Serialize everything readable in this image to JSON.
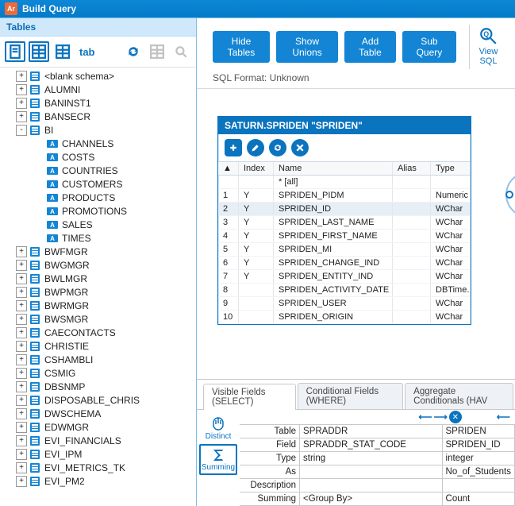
{
  "app": {
    "title": "Build Query",
    "badge": "Ar"
  },
  "left": {
    "panel_title": "Tables",
    "tab_label": "tab",
    "tree": [
      {
        "level": 0,
        "expand": "+",
        "icon": "db",
        "label": "<blank schema>"
      },
      {
        "level": 0,
        "expand": "+",
        "icon": "db",
        "label": "ALUMNI"
      },
      {
        "level": 0,
        "expand": "+",
        "icon": "db",
        "label": "BANINST1"
      },
      {
        "level": 0,
        "expand": "+",
        "icon": "db",
        "label": "BANSECR"
      },
      {
        "level": 0,
        "expand": "-",
        "icon": "db",
        "label": "BI"
      },
      {
        "level": 1,
        "expand": "",
        "icon": "tbl",
        "label": "CHANNELS"
      },
      {
        "level": 1,
        "expand": "",
        "icon": "tbl",
        "label": "COSTS"
      },
      {
        "level": 1,
        "expand": "",
        "icon": "tbl",
        "label": "COUNTRIES"
      },
      {
        "level": 1,
        "expand": "",
        "icon": "tbl",
        "label": "CUSTOMERS"
      },
      {
        "level": 1,
        "expand": "",
        "icon": "tbl",
        "label": "PRODUCTS"
      },
      {
        "level": 1,
        "expand": "",
        "icon": "tbl",
        "label": "PROMOTIONS"
      },
      {
        "level": 1,
        "expand": "",
        "icon": "tbl",
        "label": "SALES"
      },
      {
        "level": 1,
        "expand": "",
        "icon": "tbl",
        "label": "TIMES"
      },
      {
        "level": 0,
        "expand": "+",
        "icon": "db",
        "label": "BWFMGR"
      },
      {
        "level": 0,
        "expand": "+",
        "icon": "db",
        "label": "BWGMGR"
      },
      {
        "level": 0,
        "expand": "+",
        "icon": "db",
        "label": "BWLMGR"
      },
      {
        "level": 0,
        "expand": "+",
        "icon": "db",
        "label": "BWPMGR"
      },
      {
        "level": 0,
        "expand": "+",
        "icon": "db",
        "label": "BWRMGR"
      },
      {
        "level": 0,
        "expand": "+",
        "icon": "db",
        "label": "BWSMGR"
      },
      {
        "level": 0,
        "expand": "+",
        "icon": "db",
        "label": "CAECONTACTS"
      },
      {
        "level": 0,
        "expand": "+",
        "icon": "db",
        "label": "CHRISTIE"
      },
      {
        "level": 0,
        "expand": "+",
        "icon": "db",
        "label": "CSHAMBLI"
      },
      {
        "level": 0,
        "expand": "+",
        "icon": "db",
        "label": "CSMIG"
      },
      {
        "level": 0,
        "expand": "+",
        "icon": "db",
        "label": "DBSNMP"
      },
      {
        "level": 0,
        "expand": "+",
        "icon": "db",
        "label": "DISPOSABLE_CHRIS"
      },
      {
        "level": 0,
        "expand": "+",
        "icon": "db",
        "label": "DWSCHEMA"
      },
      {
        "level": 0,
        "expand": "+",
        "icon": "db",
        "label": "EDWMGR"
      },
      {
        "level": 0,
        "expand": "+",
        "icon": "db",
        "label": "EVI_FINANCIALS"
      },
      {
        "level": 0,
        "expand": "+",
        "icon": "db",
        "label": "EVI_IPM"
      },
      {
        "level": 0,
        "expand": "+",
        "icon": "db",
        "label": "EVI_METRICS_TK"
      },
      {
        "level": 0,
        "expand": "+",
        "icon": "db",
        "label": "EVI_PM2"
      }
    ]
  },
  "actions": {
    "hide_tables": "Hide Tables",
    "show_unions": "Show Unions",
    "add_table": "Add Table",
    "sub_query": "Sub Query",
    "view_sql": "View SQL"
  },
  "sql_format": "SQL Format: Unknown",
  "tablebox": {
    "title": "SATURN.SPRIDEN \"SPRIDEN\"",
    "headers": {
      "num": "",
      "index": "Index",
      "name": "Name",
      "alias": "Alias",
      "type": "Type"
    },
    "rows": [
      {
        "n": "",
        "idx": "",
        "name": "* [all]",
        "alias": "",
        "type": ""
      },
      {
        "n": "1",
        "idx": "Y",
        "name": "SPRIDEN_PIDM",
        "alias": "",
        "type": "Numeric"
      },
      {
        "n": "2",
        "idx": "Y",
        "name": "SPRIDEN_ID",
        "alias": "",
        "type": "WChar",
        "selected": true
      },
      {
        "n": "3",
        "idx": "Y",
        "name": "SPRIDEN_LAST_NAME",
        "alias": "",
        "type": "WChar"
      },
      {
        "n": "4",
        "idx": "Y",
        "name": "SPRIDEN_FIRST_NAME",
        "alias": "",
        "type": "WChar"
      },
      {
        "n": "5",
        "idx": "Y",
        "name": "SPRIDEN_MI",
        "alias": "",
        "type": "WChar"
      },
      {
        "n": "6",
        "idx": "Y",
        "name": "SPRIDEN_CHANGE_IND",
        "alias": "",
        "type": "WChar"
      },
      {
        "n": "7",
        "idx": "Y",
        "name": "SPRIDEN_ENTITY_IND",
        "alias": "",
        "type": "WChar"
      },
      {
        "n": "8",
        "idx": "",
        "name": "SPRIDEN_ACTIVITY_DATE",
        "alias": "",
        "type": "DBTime..."
      },
      {
        "n": "9",
        "idx": "",
        "name": "SPRIDEN_USER",
        "alias": "",
        "type": "WChar"
      },
      {
        "n": "10",
        "idx": "",
        "name": "SPRIDEN_ORIGIN",
        "alias": "",
        "type": "WChar"
      }
    ]
  },
  "bottom": {
    "tabs": {
      "visible": "Visible Fields (SELECT)",
      "cond": "Conditional Fields (WHERE)",
      "agg": "Aggregate Conditionals (HAV"
    },
    "side": {
      "distinct": "Distinct",
      "summing": "Summing"
    },
    "labels": {
      "table": "Table",
      "field": "Field",
      "type": "Type",
      "as": "As",
      "description": "Description",
      "summing": "Summing"
    },
    "cols": [
      {
        "table": "SPRADDR",
        "field": "SPRADDR_STAT_CODE",
        "type": "string",
        "as": "",
        "desc": "",
        "summing": "<Group By>"
      },
      {
        "table": "SPRIDEN",
        "field": "SPRIDEN_ID",
        "type": "integer",
        "as": "No_of_Students",
        "desc": "",
        "summing": "Count"
      }
    ]
  }
}
